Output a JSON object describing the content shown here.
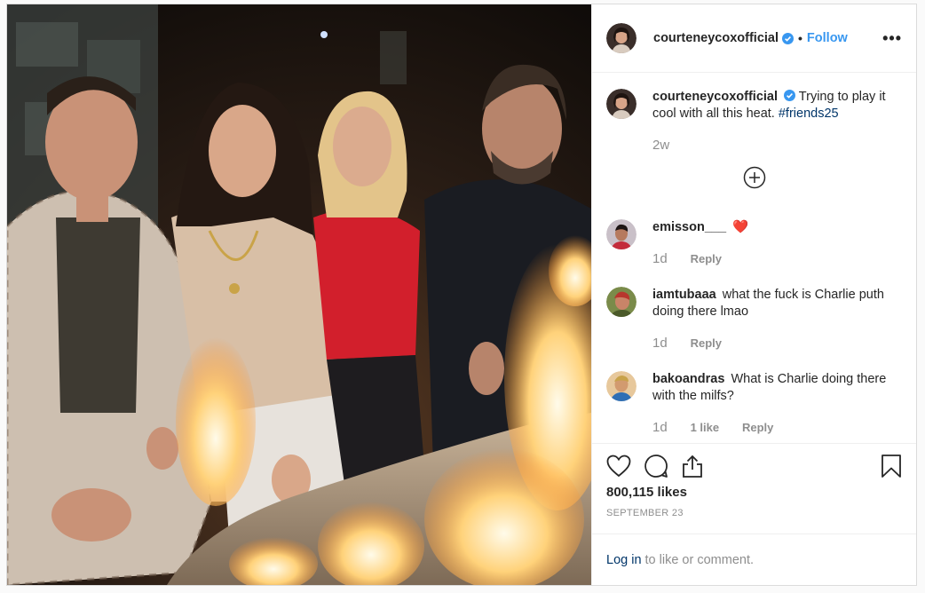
{
  "post": {
    "author": "courteneycoxofficial",
    "follow_label": "Follow",
    "separator": "•",
    "more_label": "•••",
    "caption_text": "Trying to play it cool with all this heat.",
    "caption_hashtag": "#friends25",
    "caption_age": "2w",
    "likes": "800,115 likes",
    "date": "SEPTEMBER 23",
    "login_link": "Log in",
    "login_text": "to like or comment."
  },
  "comments": [
    {
      "user": "emisson___",
      "text": "❤️",
      "age": "1d",
      "reply_label": "Reply"
    },
    {
      "user": "iamtubaaa",
      "text": "what the fuck is Charlie puth doing there lmao",
      "age": "1d",
      "reply_label": "Reply"
    },
    {
      "user": "bakoandras",
      "text": "What is Charlie doing there with the milfs?",
      "age": "1d",
      "likes": "1 like",
      "reply_label": "Reply"
    }
  ],
  "colors": {
    "link_blue": "#3897f0",
    "hashtag_blue": "#003569",
    "muted_gray": "#8e8e8e",
    "text_dark": "#262626"
  },
  "icons": [
    "verified-badge-icon",
    "more-options-icon",
    "load-more-comments-icon",
    "heart-icon",
    "comment-icon",
    "share-icon",
    "bookmark-icon"
  ]
}
